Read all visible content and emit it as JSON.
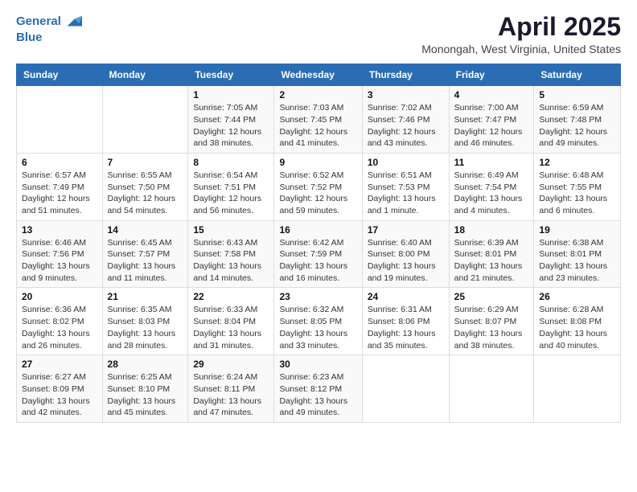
{
  "header": {
    "logo_line1": "General",
    "logo_line2": "Blue",
    "title": "April 2025",
    "subtitle": "Monongah, West Virginia, United States"
  },
  "days_of_week": [
    "Sunday",
    "Monday",
    "Tuesday",
    "Wednesday",
    "Thursday",
    "Friday",
    "Saturday"
  ],
  "weeks": [
    [
      {
        "num": "",
        "info": ""
      },
      {
        "num": "",
        "info": ""
      },
      {
        "num": "1",
        "info": "Sunrise: 7:05 AM\nSunset: 7:44 PM\nDaylight: 12 hours and 38 minutes."
      },
      {
        "num": "2",
        "info": "Sunrise: 7:03 AM\nSunset: 7:45 PM\nDaylight: 12 hours and 41 minutes."
      },
      {
        "num": "3",
        "info": "Sunrise: 7:02 AM\nSunset: 7:46 PM\nDaylight: 12 hours and 43 minutes."
      },
      {
        "num": "4",
        "info": "Sunrise: 7:00 AM\nSunset: 7:47 PM\nDaylight: 12 hours and 46 minutes."
      },
      {
        "num": "5",
        "info": "Sunrise: 6:59 AM\nSunset: 7:48 PM\nDaylight: 12 hours and 49 minutes."
      }
    ],
    [
      {
        "num": "6",
        "info": "Sunrise: 6:57 AM\nSunset: 7:49 PM\nDaylight: 12 hours and 51 minutes."
      },
      {
        "num": "7",
        "info": "Sunrise: 6:55 AM\nSunset: 7:50 PM\nDaylight: 12 hours and 54 minutes."
      },
      {
        "num": "8",
        "info": "Sunrise: 6:54 AM\nSunset: 7:51 PM\nDaylight: 12 hours and 56 minutes."
      },
      {
        "num": "9",
        "info": "Sunrise: 6:52 AM\nSunset: 7:52 PM\nDaylight: 12 hours and 59 minutes."
      },
      {
        "num": "10",
        "info": "Sunrise: 6:51 AM\nSunset: 7:53 PM\nDaylight: 13 hours and 1 minute."
      },
      {
        "num": "11",
        "info": "Sunrise: 6:49 AM\nSunset: 7:54 PM\nDaylight: 13 hours and 4 minutes."
      },
      {
        "num": "12",
        "info": "Sunrise: 6:48 AM\nSunset: 7:55 PM\nDaylight: 13 hours and 6 minutes."
      }
    ],
    [
      {
        "num": "13",
        "info": "Sunrise: 6:46 AM\nSunset: 7:56 PM\nDaylight: 13 hours and 9 minutes."
      },
      {
        "num": "14",
        "info": "Sunrise: 6:45 AM\nSunset: 7:57 PM\nDaylight: 13 hours and 11 minutes."
      },
      {
        "num": "15",
        "info": "Sunrise: 6:43 AM\nSunset: 7:58 PM\nDaylight: 13 hours and 14 minutes."
      },
      {
        "num": "16",
        "info": "Sunrise: 6:42 AM\nSunset: 7:59 PM\nDaylight: 13 hours and 16 minutes."
      },
      {
        "num": "17",
        "info": "Sunrise: 6:40 AM\nSunset: 8:00 PM\nDaylight: 13 hours and 19 minutes."
      },
      {
        "num": "18",
        "info": "Sunrise: 6:39 AM\nSunset: 8:01 PM\nDaylight: 13 hours and 21 minutes."
      },
      {
        "num": "19",
        "info": "Sunrise: 6:38 AM\nSunset: 8:01 PM\nDaylight: 13 hours and 23 minutes."
      }
    ],
    [
      {
        "num": "20",
        "info": "Sunrise: 6:36 AM\nSunset: 8:02 PM\nDaylight: 13 hours and 26 minutes."
      },
      {
        "num": "21",
        "info": "Sunrise: 6:35 AM\nSunset: 8:03 PM\nDaylight: 13 hours and 28 minutes."
      },
      {
        "num": "22",
        "info": "Sunrise: 6:33 AM\nSunset: 8:04 PM\nDaylight: 13 hours and 31 minutes."
      },
      {
        "num": "23",
        "info": "Sunrise: 6:32 AM\nSunset: 8:05 PM\nDaylight: 13 hours and 33 minutes."
      },
      {
        "num": "24",
        "info": "Sunrise: 6:31 AM\nSunset: 8:06 PM\nDaylight: 13 hours and 35 minutes."
      },
      {
        "num": "25",
        "info": "Sunrise: 6:29 AM\nSunset: 8:07 PM\nDaylight: 13 hours and 38 minutes."
      },
      {
        "num": "26",
        "info": "Sunrise: 6:28 AM\nSunset: 8:08 PM\nDaylight: 13 hours and 40 minutes."
      }
    ],
    [
      {
        "num": "27",
        "info": "Sunrise: 6:27 AM\nSunset: 8:09 PM\nDaylight: 13 hours and 42 minutes."
      },
      {
        "num": "28",
        "info": "Sunrise: 6:25 AM\nSunset: 8:10 PM\nDaylight: 13 hours and 45 minutes."
      },
      {
        "num": "29",
        "info": "Sunrise: 6:24 AM\nSunset: 8:11 PM\nDaylight: 13 hours and 47 minutes."
      },
      {
        "num": "30",
        "info": "Sunrise: 6:23 AM\nSunset: 8:12 PM\nDaylight: 13 hours and 49 minutes."
      },
      {
        "num": "",
        "info": ""
      },
      {
        "num": "",
        "info": ""
      },
      {
        "num": "",
        "info": ""
      }
    ]
  ]
}
